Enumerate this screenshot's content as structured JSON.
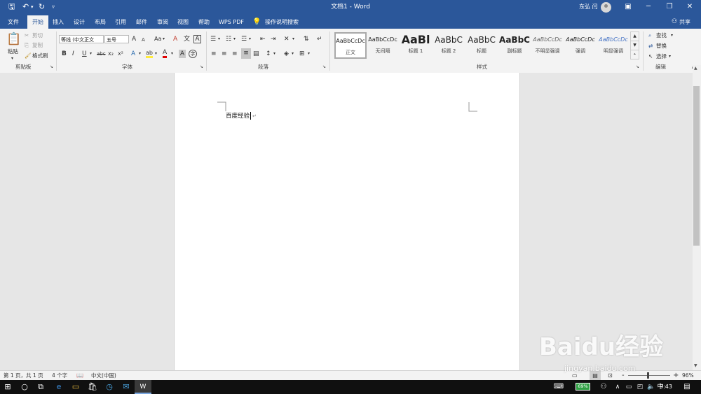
{
  "title_bar": {
    "doc_title": "文档1 - Word",
    "user_name": "东弘 闫"
  },
  "tabs": [
    "文件",
    "开始",
    "插入",
    "设计",
    "布局",
    "引用",
    "邮件",
    "审阅",
    "视图",
    "帮助",
    "WPS PDF"
  ],
  "active_tab": "开始",
  "tell_me": "操作说明搜索",
  "share_label": "共享",
  "clipboard": {
    "paste": "粘贴",
    "cut": "剪切",
    "copy": "复制",
    "format_painter": "格式刷",
    "group_label": "剪贴板"
  },
  "font": {
    "font_name": "等线 (中文正文",
    "font_size": "五号",
    "group_label": "字体",
    "size_up": "A",
    "size_down": "A",
    "case_label": "Aa",
    "clear_format": "A",
    "phonetic": "文",
    "border_char": "A",
    "bold": "B",
    "italic": "I",
    "underline": "U",
    "strikethrough": "abc",
    "subscript": "x₂",
    "superscript": "x²",
    "text_effects": "A",
    "highlight": "ab",
    "font_color": "A",
    "char_shading": "A",
    "enclose_char": "字"
  },
  "paragraph": {
    "group_label": "段落"
  },
  "styles": {
    "group_label": "样式",
    "items": [
      {
        "preview": "AaBbCcDc",
        "name": "正文"
      },
      {
        "preview": "AaBbCcDc",
        "name": "无间隔"
      },
      {
        "preview": "AaBl",
        "name": "标题 1"
      },
      {
        "preview": "AaBbC",
        "name": "标题 2"
      },
      {
        "preview": "AaBbC",
        "name": "标题"
      },
      {
        "preview": "AaBbC",
        "name": "副标题"
      },
      {
        "preview": "AaBbCcDc",
        "name": "不明显强调"
      },
      {
        "preview": "AaBbCcDc",
        "name": "强调"
      },
      {
        "preview": "AaBbCcDc",
        "name": "明显强调"
      }
    ]
  },
  "editing": {
    "find": "查找",
    "replace": "替换",
    "select": "选择",
    "group_label": "编辑"
  },
  "document": {
    "text": "百度经验"
  },
  "status": {
    "page": "第 1 页，共 1 页",
    "words": "4 个字",
    "language": "中文(中国)",
    "zoom": "96%",
    "zoom_minus": "-",
    "zoom_plus": "+"
  },
  "taskbar": {
    "battery": "69%",
    "ime": "中",
    "time": "9:43"
  },
  "watermark": {
    "main": "Baidu经验",
    "sub": "jingyan.baidu.com"
  },
  "colors": {
    "word_blue": "#2b579a",
    "ribbon_bg": "#f3f3f3",
    "battery_green": "#2ea043"
  }
}
